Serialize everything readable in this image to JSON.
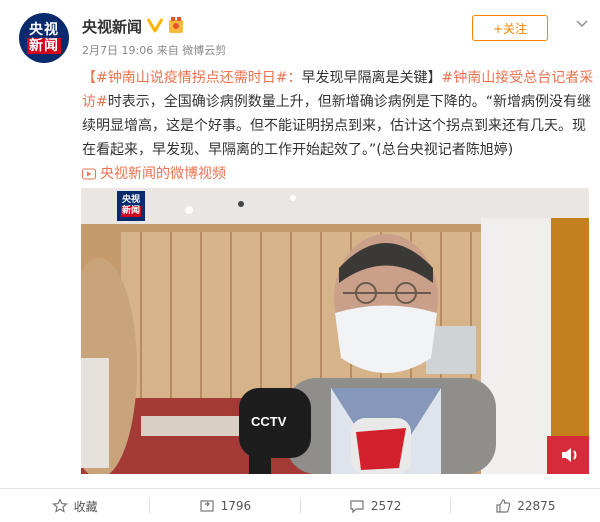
{
  "header": {
    "avatar_line1": "央视",
    "avatar_line2": "新闻",
    "name": "央视新闻",
    "verified_icon": "verified-v-icon",
    "medal_icon": "medal-badge-icon",
    "time": "2月7日 19:06",
    "source": "来自 微博云剪",
    "follow_label": "+关注"
  },
  "post": {
    "tag1": "【#钟南山说疫情拐点还需时日#：",
    "text1": "早发现早隔离是关键】",
    "tag2": "#钟南山接受总台记者采访#",
    "text2": "时表示，全国确诊病例数量上升，但新增确诊病例是下降的。“新增病例没有继续明显增高，这是个好事。但不能证明拐点到来，估计这个拐点到来还有几天。现在看起来，早发现、早隔离的工作开始起效了。”(总台央视记者陈旭婷)",
    "video_link": "央视新闻的微博视频"
  },
  "video": {
    "logo_line1": "央视",
    "logo_line2": "新闻",
    "mic_label": "CCTV"
  },
  "actions": {
    "favorite_label": "收藏",
    "repost_count": "1796",
    "comment_count": "2572",
    "like_count": "22875"
  },
  "colors": {
    "accent": "#eb7350",
    "follow": "#ff8200",
    "brand_blue": "#0a2a6e",
    "brand_red": "#d5001c"
  }
}
